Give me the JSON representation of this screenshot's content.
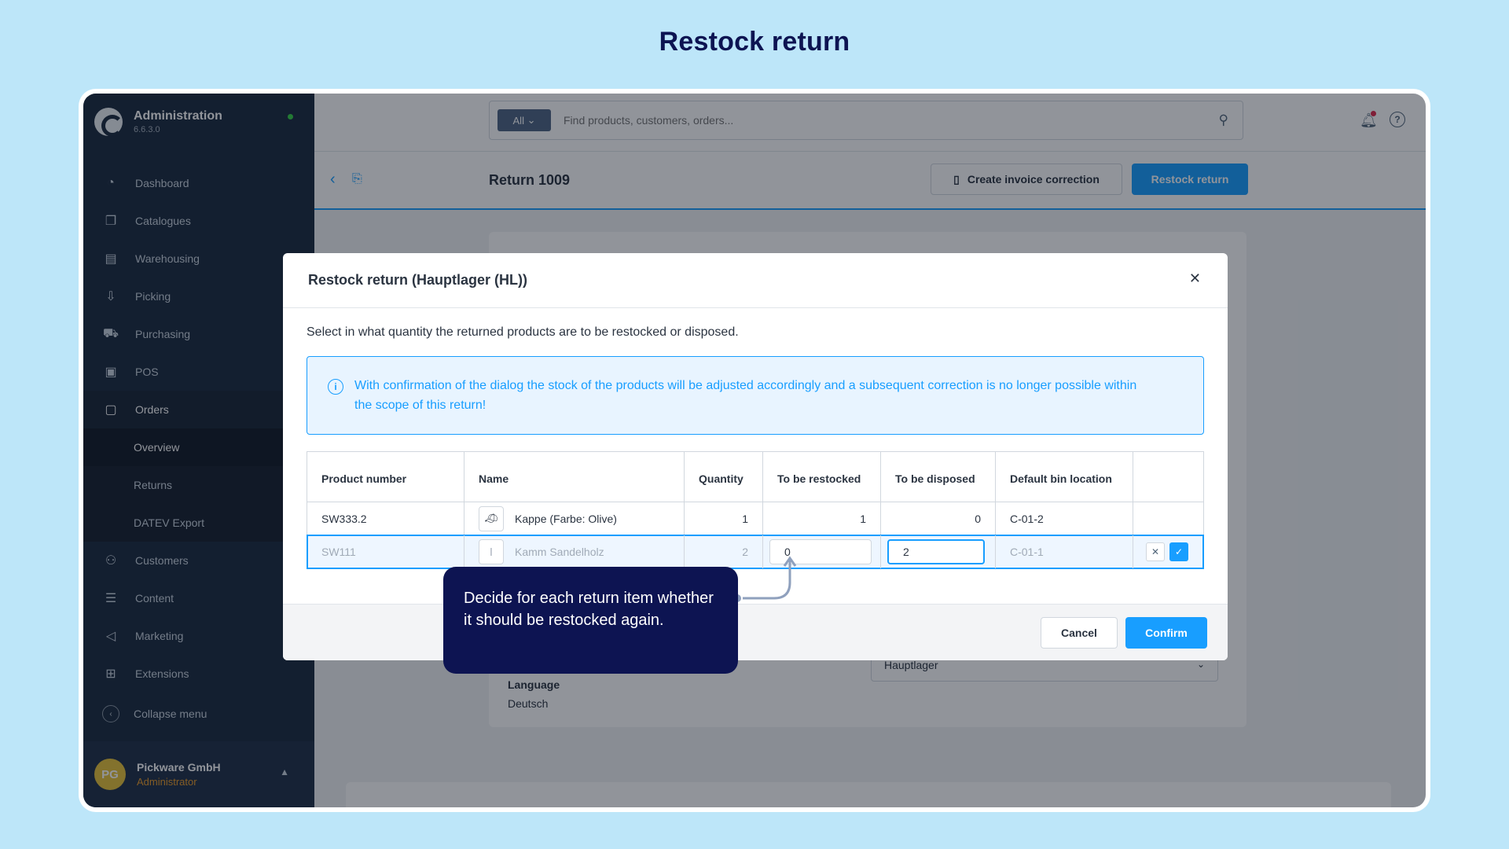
{
  "page_title": "Restock return",
  "sidebar": {
    "brand_name": "Administration",
    "brand_version": "6.6.3.0",
    "items": [
      {
        "label": "Dashboard",
        "icon": "dashboard-icon",
        "glyph": "◔"
      },
      {
        "label": "Catalogues",
        "icon": "catalogue-icon",
        "glyph": "❐"
      },
      {
        "label": "Warehousing",
        "icon": "warehouse-icon",
        "glyph": "▤"
      },
      {
        "label": "Picking",
        "icon": "picking-icon",
        "glyph": "⇩"
      },
      {
        "label": "Purchasing",
        "icon": "truck-icon",
        "glyph": "⛟"
      },
      {
        "label": "POS",
        "icon": "pos-icon",
        "glyph": "▣"
      },
      {
        "label": "Orders",
        "icon": "orders-icon",
        "glyph": "▢"
      }
    ],
    "sub_items": [
      "Overview",
      "Returns",
      "DATEV Export"
    ],
    "items_after": [
      {
        "label": "Customers",
        "icon": "customers-icon",
        "glyph": "⚇"
      },
      {
        "label": "Content",
        "icon": "content-icon",
        "glyph": "☰"
      },
      {
        "label": "Marketing",
        "icon": "megaphone-icon",
        "glyph": "◁"
      },
      {
        "label": "Extensions",
        "icon": "extensions-icon",
        "glyph": "⊞"
      }
    ],
    "collapse_label": "Collapse menu",
    "user": {
      "initials": "PG",
      "name": "Pickware GmbH",
      "role": "Administrator"
    }
  },
  "topbar": {
    "search_scope": "All",
    "search_placeholder": "Find products, customers, orders..."
  },
  "actionbar": {
    "title": "Return 1009",
    "invoice_button": "Create invoice correction",
    "restock_button": "Restock return"
  },
  "card": {
    "warehouse_select": "Hauptlager",
    "language_label": "Language",
    "language_value": "Deutsch"
  },
  "modal": {
    "title": "Restock return (Hauptlager (HL))",
    "description": "Select in what quantity the returned products are to be restocked or disposed.",
    "alert": "With confirmation of the dialog the stock of the products will be adjusted accordingly and a subsequent correction is no longer possible within the scope of this return!",
    "columns": [
      "Product number",
      "Name",
      "Quantity",
      "To be restocked",
      "To be disposed",
      "Default bin location"
    ],
    "rows": [
      {
        "product_number": "SW333.2",
        "name": "Kappe (Farbe: Olive)",
        "quantity": "1",
        "restocked": "1",
        "disposed": "0",
        "bin": "C-01-2"
      },
      {
        "product_number": "SW111",
        "name": "Kamm Sandelholz",
        "quantity": "2",
        "restocked": "0",
        "disposed": "2",
        "bin": "C-01-1"
      }
    ],
    "cancel": "Cancel",
    "confirm": "Confirm"
  },
  "tooltip": "Decide for each return item whether it should be restocked again.",
  "colors": {
    "accent": "#189eff",
    "sidebar": "#1b2a3e",
    "tooltip": "#0d1452",
    "background": "#bde6f9"
  }
}
